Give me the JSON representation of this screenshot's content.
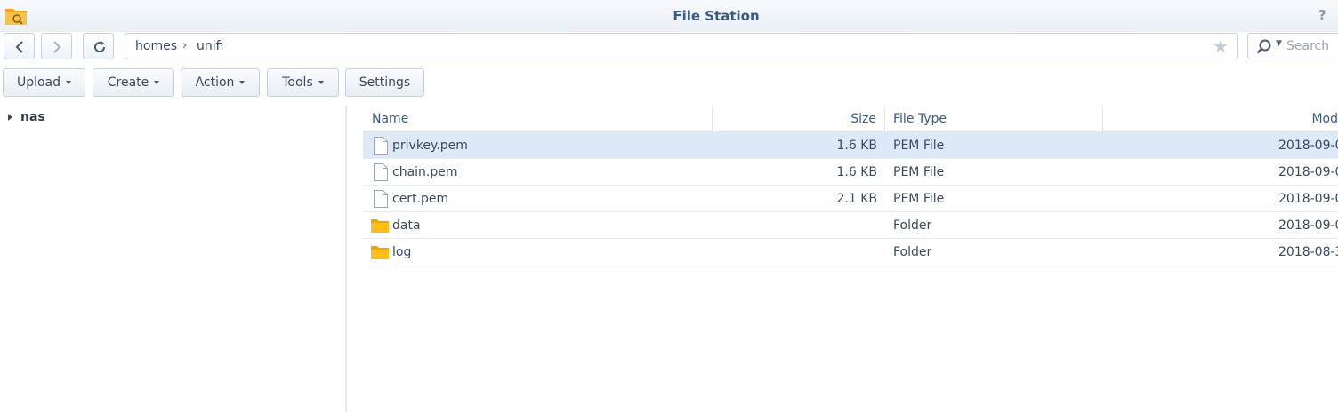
{
  "window": {
    "title": "File Station",
    "help_glyph": "?"
  },
  "nav": {
    "back_icon": "chevron-left-icon",
    "forward_icon": "chevron-right-icon",
    "refresh_icon": "refresh-icon"
  },
  "path": {
    "crumbs": [
      "homes",
      "unifi"
    ],
    "separator": "›",
    "favorite_icon": "star-icon"
  },
  "search": {
    "placeholder": "Search",
    "icon": "search-icon"
  },
  "toolbar": {
    "upload": "Upload",
    "create": "Create",
    "action": "Action",
    "tools": "Tools",
    "settings": "Settings"
  },
  "tree": {
    "root": "nas"
  },
  "grid": {
    "columns": {
      "name": "Name",
      "size": "Size",
      "type": "File Type",
      "modified": "Mod"
    },
    "rows": [
      {
        "name": "privkey.pem",
        "size": "1.6 KB",
        "type": "PEM File",
        "modified": "2018-09-0",
        "icon": "file-icon",
        "selected": true
      },
      {
        "name": "chain.pem",
        "size": "1.6 KB",
        "type": "PEM File",
        "modified": "2018-09-0",
        "icon": "file-icon",
        "selected": false
      },
      {
        "name": "cert.pem",
        "size": "2.1 KB",
        "type": "PEM File",
        "modified": "2018-09-0",
        "icon": "file-icon",
        "selected": false
      },
      {
        "name": "data",
        "size": "",
        "type": "Folder",
        "modified": "2018-09-0",
        "icon": "folder-icon",
        "selected": false
      },
      {
        "name": "log",
        "size": "",
        "type": "Folder",
        "modified": "2018-08-3",
        "icon": "folder-icon",
        "selected": false
      }
    ]
  },
  "colors": {
    "accent": "#3b5a7f",
    "selected_row": "#dde9f7",
    "folder": "#f5b400"
  }
}
